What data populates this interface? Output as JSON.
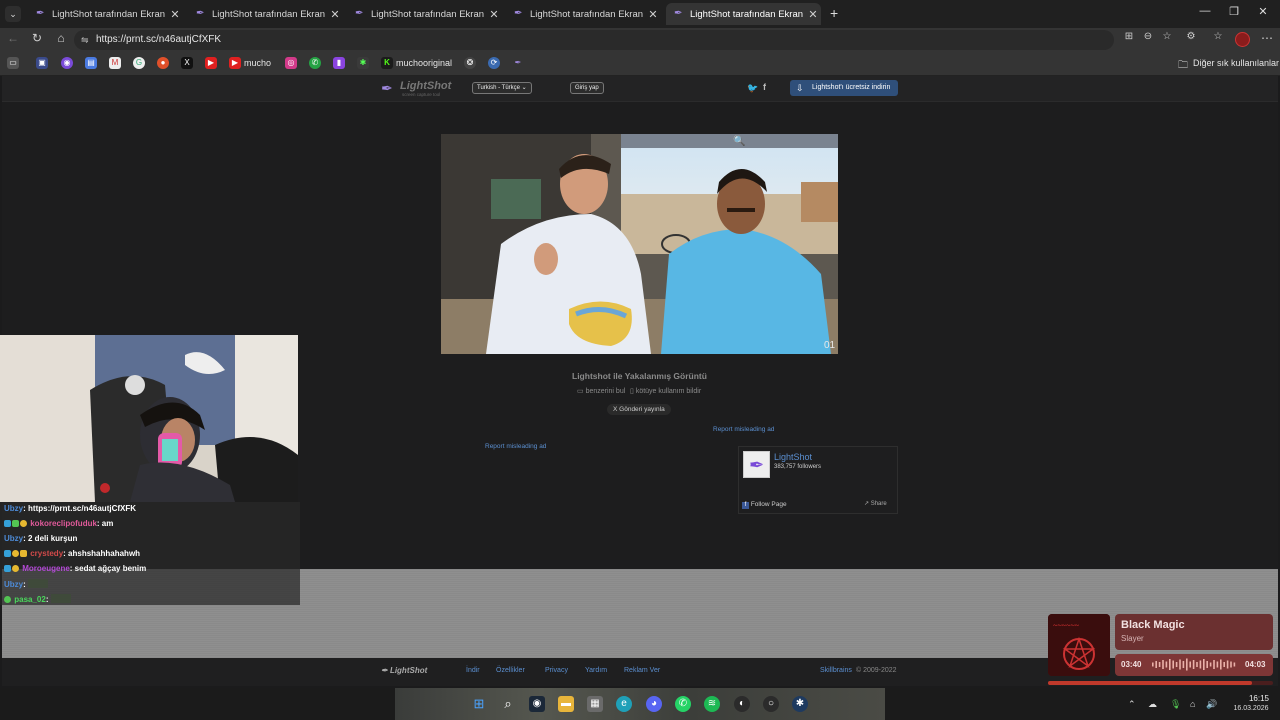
{
  "tabs": [
    {
      "title": "LightShot tarafından Ekran Görüntüsü"
    },
    {
      "title": "LightShot tarafından Ekran Görüntüsü"
    },
    {
      "title": "LightShot tarafından Ekran Görüntüsü"
    },
    {
      "title": "LightShot tarafından Ekran Görüntüsü"
    },
    {
      "title": "LightShot tarafından Ekran Görüntüsü"
    }
  ],
  "new_tab_symbol": "+",
  "address": {
    "url": "https://prnt.sc/n46autjCfXFK"
  },
  "bookmarks": {
    "mucho": "mucho",
    "muchooriginal": "muchooriginal",
    "other": "Diğer sık kullanılanlar"
  },
  "lightshot": {
    "logo": "LightShot",
    "logo_sub": "screen capture tool",
    "language": "Turkish - Türkçe",
    "login": "Giriş yap",
    "download": "Lightshot'ı ücretsiz indirin",
    "caption": "Lightshot ile Yakalanmış Görüntü",
    "similar": "benzerini bul",
    "report": "kötüye kullanım bildir",
    "tweet": "Gönderi yayınla",
    "report_ad": "Report misleading ad",
    "photo_badge": "01",
    "fb": {
      "name": "LightShot",
      "followers": "383,757 followers",
      "follow": "Follow Page",
      "share": "Share"
    },
    "footer": {
      "logo": "LightShot",
      "links": [
        "İndir",
        "Özellikler",
        "Privacy",
        "Yardım",
        "Reklam Ver"
      ],
      "company": "Skillbrains",
      "copy": "© 2009-2022"
    }
  },
  "chat": [
    {
      "user": "Ubzy",
      "msg": ": https://prnt.sc/n46autjCfXFK",
      "color": "#4d8bd8"
    },
    {
      "user": "kokoreclipofuduk",
      "msg": ": am",
      "color": "#e05a9a"
    },
    {
      "user": "Ubzy",
      "msg": ": 2 deli kurşun",
      "color": "#4d8bd8"
    },
    {
      "user": "crystedy",
      "msg": ": ahshshahhahahwh",
      "color": "#d24a4a"
    },
    {
      "user": "Moroeugene",
      "msg": ": sedat ağçay benim",
      "color": "#b54ad8"
    },
    {
      "user": "Ubzy",
      "msg": ":",
      "color": "#4d8bd8"
    },
    {
      "user": "pasa_02",
      "msg": ":",
      "color": "#4ad85c"
    }
  ],
  "music": {
    "title": "Black Magic",
    "artist": "Slayer",
    "elapsed": "03:40",
    "total": "04:03",
    "progress": 0.905
  },
  "clock": {
    "time": "16:15",
    "date": "16.03.2026"
  },
  "colors": {
    "accent": "#a089e0",
    "link": "#5b8fd0",
    "music_bg": "#6b3030"
  }
}
